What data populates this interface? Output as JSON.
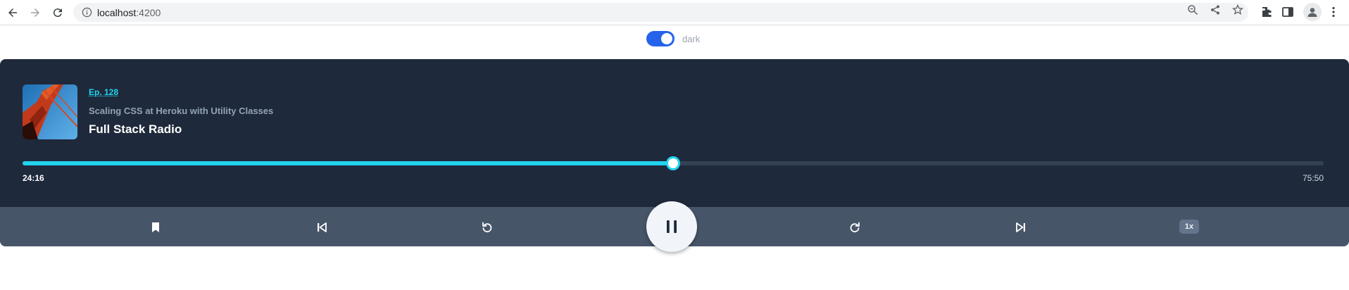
{
  "browser": {
    "url_host": "localhost",
    "url_port": ":4200"
  },
  "theme_toggle": {
    "label": "dark",
    "checked": true
  },
  "player": {
    "episode_label": "Ep. 128",
    "episode_title": "Scaling CSS at Heroku with Utility Classes",
    "show_title": "Full Stack Radio",
    "current_time": "24:16",
    "total_time": "75:50",
    "progress": 0.5
  },
  "controls": {
    "speed_label": "1x",
    "state": "playing"
  },
  "colors": {
    "accent": "#22d3ee",
    "panel": "#1e293b",
    "control_bar": "#475569",
    "toggle": "#2563eb"
  }
}
